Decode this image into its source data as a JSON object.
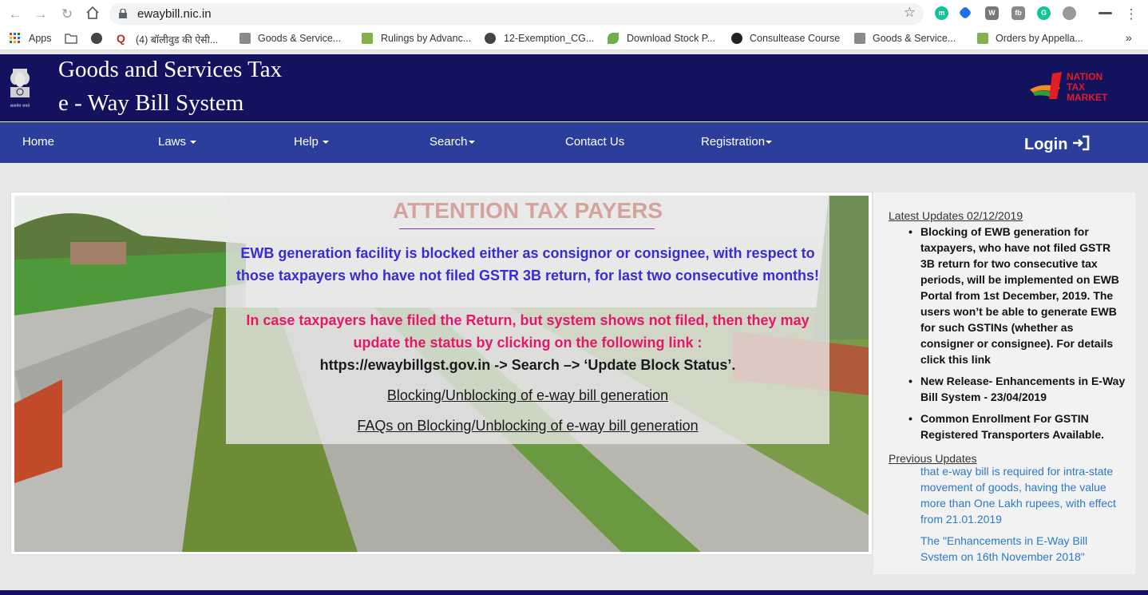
{
  "browser": {
    "url": "ewaybill.nic.in",
    "bookmarks": [
      "Apps",
      "(4) बॉलीवुड की ऐसी...",
      "Goods & Service...",
      "Rulings by Advanc...",
      "12-Exemption_CG...",
      "Download Stock P...",
      "Consultease Course",
      "Goods & Service...",
      "Orders by Appella..."
    ],
    "more": "»"
  },
  "header": {
    "title_line1": "Goods and Services Tax",
    "title_line2": "e - Way Bill System",
    "emblem_caption": "सत्यमेव जयते",
    "logo_text": [
      "NATION",
      "TAX",
      "MARKET"
    ]
  },
  "nav": {
    "items": [
      "Home",
      "Laws",
      "Help",
      "Search",
      "Contact Us",
      "Registration"
    ],
    "login": "Login"
  },
  "notice": {
    "title": "ATTENTION TAX PAYERS",
    "blue_line1": "EWB generation facility is blocked either as consignor or consignee, with respect to",
    "blue_line2": "those taxpayers who have not filed GSTR 3B return, for last two consecutive months!",
    "pink_line1": "In case taxpayers have filed the Return, but system shows not filed, then they may",
    "pink_line2": "update the status by clicking on the following link :",
    "black_line": "https://ewaybillgst.gov.in -> Search –> ‘Update Block Status’.",
    "link1": "Blocking/Unblocking of e-way bill generation",
    "link2": "FAQs on Blocking/Unblocking of e-way bill generation"
  },
  "side": {
    "latest_heading": "Latest Updates 02/12/2019",
    "latest_items": [
      "Blocking of EWB generation for taxpayers, who have not filed GSTR 3B return for two consecutive tax periods, will be implemented on EWB Portal from 1st December, 2019. The users won’t be able to generate EWB for such GSTINs (whether as consigner or consignee). For details click this link",
      "New Release- Enhancements in E-Way Bill System - 23/04/2019",
      "Common Enrollment For GSTIN Registered Transporters Available."
    ],
    "previous_heading": "Previous Updates",
    "previous_items": [
      "that e-way bill is required for intra-state movement of goods, having the value more than One Lakh rupees, with effect from 21.01.2019",
      "The \"Enhancements in E-Way Bill System on 16th November 2018\""
    ]
  }
}
